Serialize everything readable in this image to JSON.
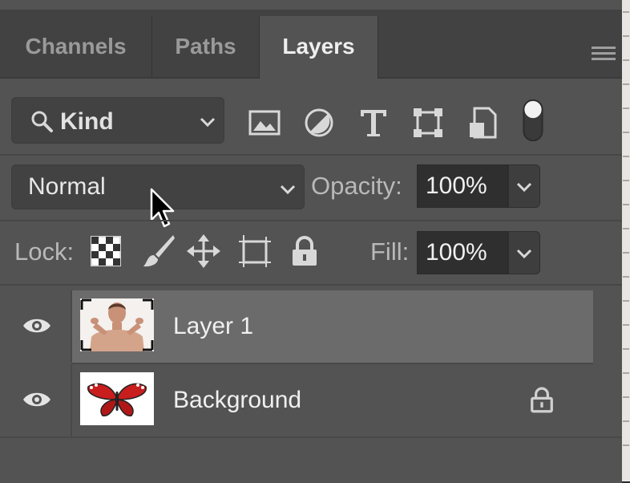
{
  "tabs": [
    {
      "label": "Channels",
      "active": false
    },
    {
      "label": "Paths",
      "active": false
    },
    {
      "label": "Layers",
      "active": true
    }
  ],
  "filter": {
    "kind_label": "Kind",
    "icons": [
      "image-filter-icon",
      "adjustment-filter-icon",
      "type-filter-icon",
      "shape-filter-icon",
      "smart-object-filter-icon",
      "filter-toggle-icon"
    ]
  },
  "blend": {
    "mode": "Normal",
    "opacity_label": "Opacity:",
    "opacity_value": "100%"
  },
  "lock": {
    "label": "Lock:",
    "icons": [
      "lock-transparent-pixels-icon",
      "lock-image-pixels-icon",
      "lock-position-icon",
      "lock-artboard-icon",
      "lock-all-icon"
    ],
    "fill_label": "Fill:",
    "fill_value": "100%"
  },
  "layers": [
    {
      "name": "Layer 1",
      "selected": true,
      "visible": true,
      "locked": false,
      "thumb": "woman-portrait"
    },
    {
      "name": "Background",
      "selected": false,
      "visible": true,
      "locked": true,
      "thumb": "red-butterfly"
    }
  ],
  "colors": {
    "panel": "#535353",
    "tab_bar": "#424242",
    "selected_row": "#6b6b6b",
    "field": "#2f2f2f"
  }
}
